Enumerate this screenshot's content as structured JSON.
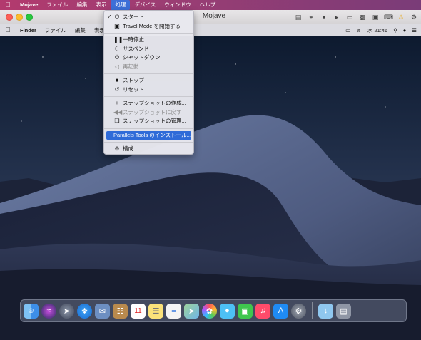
{
  "host_menubar": {
    "apple": "",
    "items": [
      "Mojave",
      "ファイル",
      "編集",
      "表示",
      "処理",
      "デバイス",
      "ウィンドウ",
      "ヘルプ"
    ],
    "active_index": 4
  },
  "vm_window": {
    "title": "Mojave"
  },
  "guest_menubar": {
    "apple": "",
    "items": [
      "Finder",
      "ファイル",
      "編集",
      "表示"
    ],
    "clock": "水 21:46"
  },
  "action_menu": {
    "items": {
      "start": "スタート",
      "travel_mode": "Travel Mode を開始する",
      "pause": "一時停止",
      "suspend": "サスペンド",
      "shutdown": "シャットダウン",
      "restart": "再起動",
      "stop": "ストップ",
      "reset": "リセット",
      "take_snapshot": "スナップショットの作成...",
      "revert_snapshot": "スナップショットに戻す",
      "manage_snapshots": "スナップショットの管理...",
      "install_tools": "Parallels Tools のインストール...",
      "configure": "構成..."
    },
    "checked": "start",
    "highlighted": "install_tools",
    "disabled": [
      "restart",
      "revert_snapshot"
    ]
  },
  "colors": {
    "host_menubar_accent": "#3d6fd8",
    "menu_highlight": "#2f6bd8"
  },
  "dock": {
    "apps": [
      "finder-icon",
      "siri-icon",
      "launchpad-icon",
      "safari-icon",
      "mail-stamp-icon",
      "contacts-icon",
      "calendar-icon",
      "notes-icon",
      "reminders-icon",
      "maps-icon",
      "photos-icon",
      "messages-icon",
      "facetime-icon",
      "music-icon",
      "app-store-icon",
      "system-preferences-icon",
      "downloads-folder-icon",
      "trash-icon"
    ],
    "calendar_day": "11"
  }
}
